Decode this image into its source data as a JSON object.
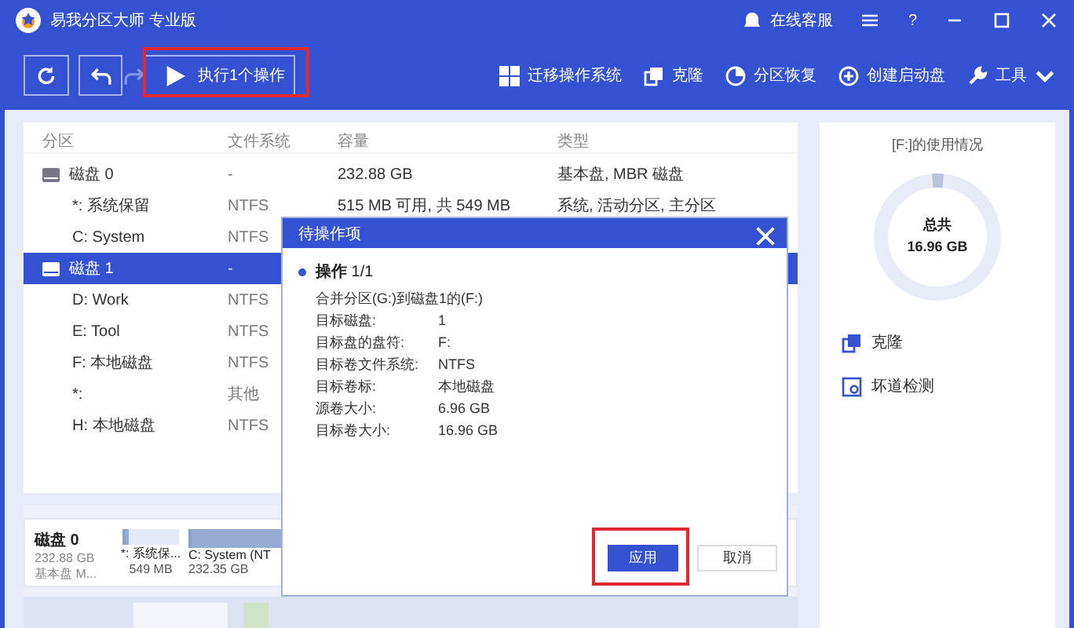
{
  "window": {
    "title": "易我分区大师 专业版",
    "support": "在线客服",
    "help": "?"
  },
  "toolbar": {
    "undo_enabled": true,
    "redo_enabled": false,
    "execute": "执行1个操作",
    "execute_highlighted": true,
    "tools": [
      {
        "kind": "windows",
        "label": "迁移操作系统"
      },
      {
        "kind": "clone",
        "label": "克隆"
      },
      {
        "kind": "recover",
        "label": "分区恢复"
      },
      {
        "kind": "boot",
        "label": "创建启动盘"
      },
      {
        "kind": "tools",
        "label": "工具"
      }
    ]
  },
  "table": {
    "columns": [
      "分区",
      "文件系统",
      "容量",
      "类型"
    ],
    "rows": [
      {
        "kind": "disk",
        "selected": false,
        "cells": [
          "磁盘 0",
          "-",
          "232.88 GB",
          "基本盘, MBR 磁盘"
        ]
      },
      {
        "kind": "partition",
        "selected": false,
        "cells": [
          "*: 系统保留",
          "NTFS",
          "515 MB 可用, 共 549 MB",
          "系统, 活动分区, 主分区"
        ]
      },
      {
        "kind": "partition",
        "selected": false,
        "cells": [
          "C: System",
          "NTFS"
        ]
      },
      {
        "kind": "disk",
        "selected": true,
        "cells": [
          "磁盘 1",
          "-"
        ]
      },
      {
        "kind": "partition",
        "selected": false,
        "cells": [
          "D: Work",
          "NTFS"
        ]
      },
      {
        "kind": "partition",
        "selected": false,
        "cells": [
          "E: Tool",
          "NTFS"
        ]
      },
      {
        "kind": "partition",
        "selected": false,
        "cells": [
          "F: 本地磁盘",
          "NTFS"
        ]
      },
      {
        "kind": "partition",
        "selected": false,
        "cells": [
          "*:",
          "其他"
        ]
      },
      {
        "kind": "partition",
        "selected": false,
        "cells": [
          "H: 本地磁盘",
          "NTFS"
        ]
      }
    ]
  },
  "disk_map": {
    "name": "磁盘 0",
    "size": "232.88 GB",
    "type": "基本盘 M...",
    "partitions": [
      {
        "label": "*: 系统保...",
        "size": "549 MB",
        "level": 0.06
      },
      {
        "label": "C: System (NT",
        "size": "232.35 GB",
        "level": 0.95
      }
    ]
  },
  "usage": {
    "title": "[F:]的使用情况",
    "total_label": "总共",
    "total": "16.96 GB",
    "level": 0.03,
    "actions": [
      {
        "kind": "clone",
        "label": "克隆"
      },
      {
        "kind": "check",
        "label": "坏道检测"
      }
    ]
  },
  "dialog": {
    "title": "待操作项",
    "heading": "**操作** 1/1",
    "summary": "合并分区(G:)到磁盘1的(F:)",
    "fields": [
      {
        "label": "目标磁盘:",
        "value": "1"
      },
      {
        "label": "目标盘的盘符:",
        "value": "F:"
      },
      {
        "label": "目标卷文件系统:",
        "value": "NTFS"
      },
      {
        "label": "目标卷标:",
        "value": "本地磁盘"
      },
      {
        "label": "源卷大小:",
        "value": "6.96 GB"
      },
      {
        "label": "目标卷大小:",
        "value": "16.96 GB"
      }
    ],
    "apply": "应用",
    "cancel": "取消",
    "apply_highlighted": true
  }
}
